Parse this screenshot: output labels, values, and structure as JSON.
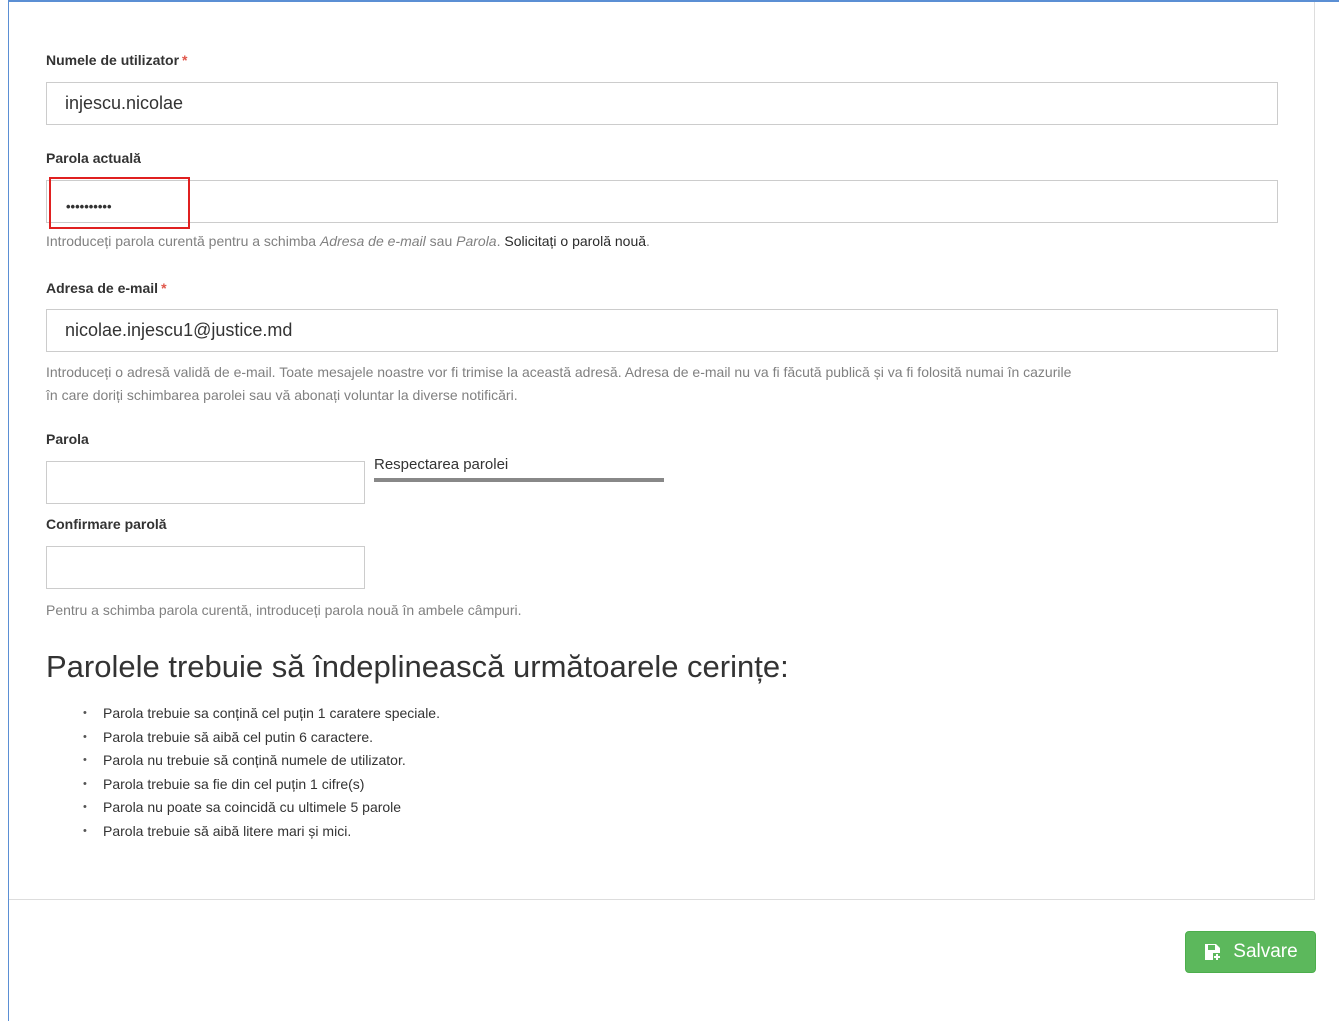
{
  "username": {
    "label": "Numele de utilizator",
    "required_mark": "*",
    "value": "injescu.nicolae"
  },
  "current_password": {
    "label": "Parola actuală",
    "masked_value": "••••••••••",
    "help_prefix": "Introduceți parola curentă pentru a schimba ",
    "help_em1": "Adresa de e-mail",
    "help_mid": " sau ",
    "help_em2": "Parola",
    "help_suffix": ". ",
    "help_link": "Solicitați o parolă nouă",
    "help_end": "."
  },
  "email": {
    "label": "Adresa de e-mail",
    "required_mark": "*",
    "value": "nicolae.injescu1@justice.md",
    "help_line1": "Introduceți o adresă validă de e-mail. Toate mesajele noastre vor fi trimise la această adresă. Adresa de e-mail nu va fi făcută publică și va fi folosită numai în cazurile",
    "help_line2": "în care doriți schimbarea parolei sau vă abonați voluntar la diverse notificări."
  },
  "password": {
    "label": "Parola",
    "value": "",
    "strength_label": "Respectarea parolei",
    "strength_level": 0
  },
  "confirm_password": {
    "label": "Confirmare parolă",
    "value": "",
    "help": "Pentru a schimba parola curentă, introduceți parola nouă în ambele câmpuri."
  },
  "requirements": {
    "title": "Parolele trebuie să îndeplinească următoarele cerințe:",
    "items": [
      "Parola trebuie sa conțină cel puțin 1 caratere speciale.",
      "Parola trebuie să aibă cel putin 6 caractere.",
      "Parola nu trebuie să conțină numele de utilizator.",
      "Parola trebuie sa fie din cel puțin 1 cifre(s)",
      "Parola nu poate sa coincidă cu ultimele 5 parole",
      "Parola trebuie să aibă litere mari și mici."
    ]
  },
  "actions": {
    "save_label": "Salvare",
    "save_icon": "save-icon"
  },
  "colors": {
    "save_button": "#5cb85c",
    "highlight_box": "#e02020",
    "required_mark": "#e0564a",
    "help_text": "#808080"
  }
}
